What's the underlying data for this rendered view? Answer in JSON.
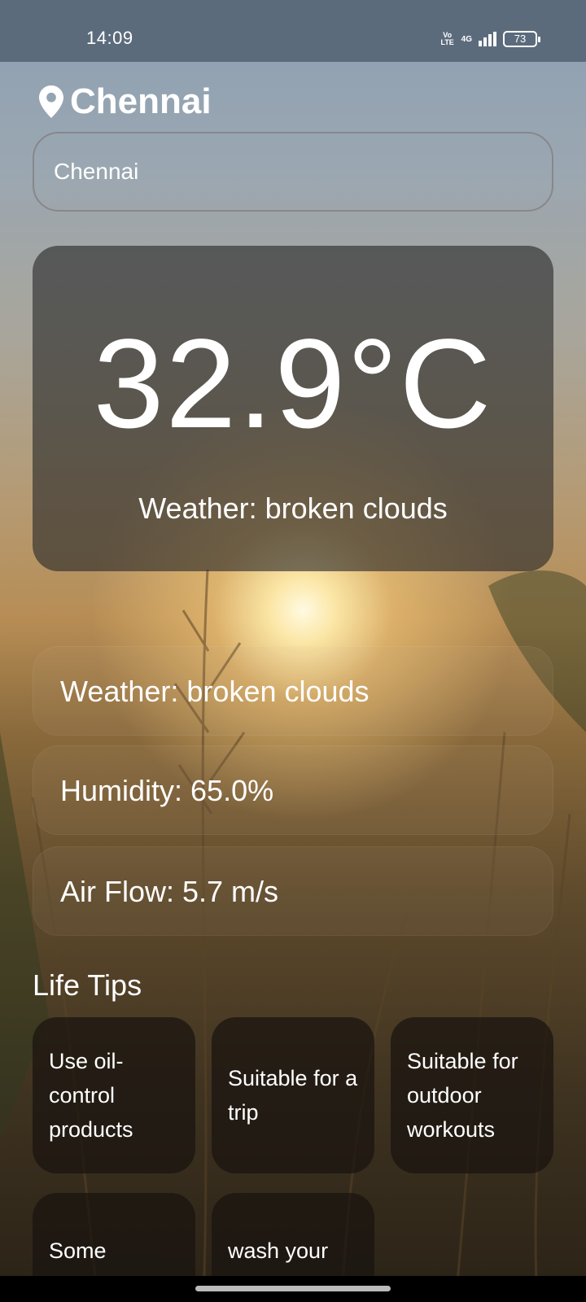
{
  "status_bar": {
    "time": "14:09",
    "volte_line1": "Vo",
    "volte_line2": "LTE",
    "network": "4G",
    "battery": "73"
  },
  "header": {
    "city": "Chennai",
    "icon": "location-pin-icon"
  },
  "search": {
    "value": "Chennai"
  },
  "current": {
    "temperature": "32.9°C",
    "description": "Weather: broken clouds"
  },
  "details": [
    {
      "label": "Weather: broken clouds"
    },
    {
      "label": "Humidity: 65.0%"
    },
    {
      "label": "Air Flow: 5.7 m/s"
    }
  ],
  "life_tips": {
    "title": "Life Tips",
    "tips": [
      {
        "text": "Use oil-control products"
      },
      {
        "text": "Suitable for a trip"
      },
      {
        "text": "Suitable for outdoor workouts"
      },
      {
        "text": "Some"
      },
      {
        "text": "wash your"
      }
    ]
  },
  "colors": {
    "status_bar_bg": "#5c6b7c",
    "card_bg": "#282828"
  }
}
